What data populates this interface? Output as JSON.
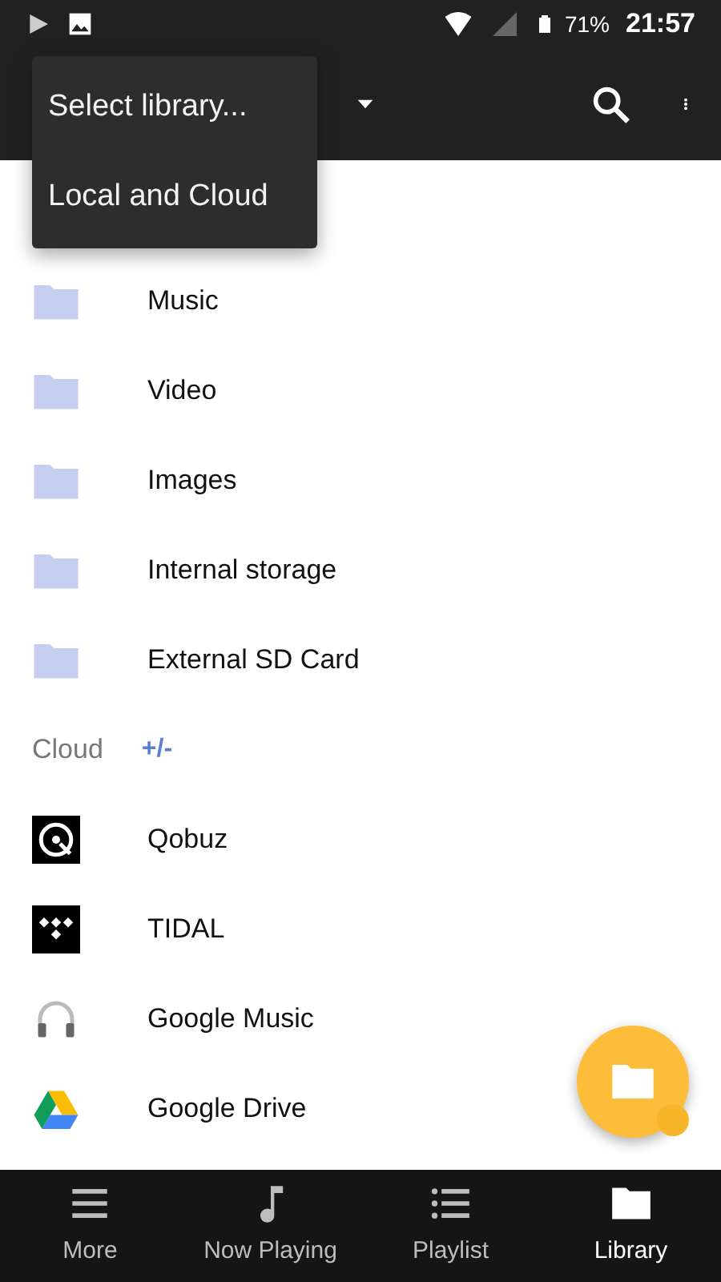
{
  "status_bar": {
    "battery": "71%",
    "time": "21:57"
  },
  "menu": {
    "items": [
      {
        "label": "Select library..."
      },
      {
        "label": "Local and Cloud"
      }
    ]
  },
  "local_items": [
    {
      "label": "Music"
    },
    {
      "label": "Video"
    },
    {
      "label": "Images"
    },
    {
      "label": "Internal storage"
    },
    {
      "label": "External SD Card"
    }
  ],
  "cloud_section": {
    "title": "Cloud",
    "action": "+/-"
  },
  "cloud_items": [
    {
      "label": "Qobuz",
      "kind": "qobuz"
    },
    {
      "label": "TIDAL",
      "kind": "tidal"
    },
    {
      "label": "Google Music",
      "kind": "headphones"
    },
    {
      "label": "Google Drive",
      "kind": "drive"
    }
  ],
  "bottom_nav": [
    {
      "label": "More",
      "kind": "menu",
      "selected": false
    },
    {
      "label": "Now Playing",
      "kind": "note",
      "selected": false
    },
    {
      "label": "Playlist",
      "kind": "list",
      "selected": false
    },
    {
      "label": "Library",
      "kind": "folder",
      "selected": true
    }
  ]
}
